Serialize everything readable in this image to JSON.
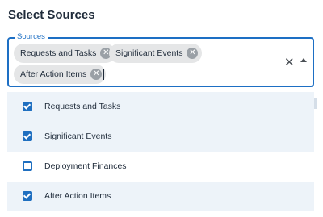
{
  "title": "Select Sources",
  "field": {
    "legend": "Sources",
    "chips": [
      "Requests and Tasks",
      "Significant Events",
      "After Action Items"
    ],
    "input_value": ""
  },
  "options": [
    {
      "label": "Requests and Tasks",
      "checked": true
    },
    {
      "label": "Significant Events",
      "checked": true
    },
    {
      "label": "Deployment Finances",
      "checked": false
    },
    {
      "label": "After Action Items",
      "checked": true
    }
  ],
  "colors": {
    "accent": "#1d6fc4",
    "chip_bg": "#e5e6e7",
    "selected_row_bg": "#edf3f9"
  },
  "icons": {
    "clear": "close-icon",
    "toggle": "caret-up-icon",
    "chip_remove": "cancel-circle-icon"
  }
}
